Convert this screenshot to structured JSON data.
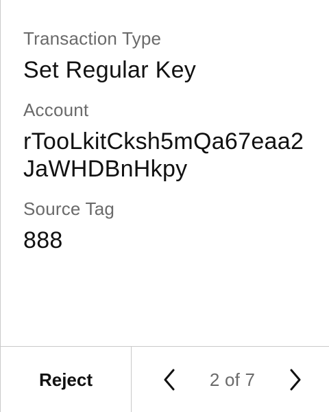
{
  "fields": {
    "transaction_type": {
      "label": "Transaction Type",
      "value": "Set Regular Key"
    },
    "account": {
      "label": "Account",
      "value": "rTooLkitCksh5mQa67eaa2JaWHDBnHkpy"
    },
    "source_tag": {
      "label": "Source Tag",
      "value": "888"
    }
  },
  "footer": {
    "reject_label": "Reject",
    "page_indicator": "2 of 7",
    "prev_icon": "chevron-left-icon",
    "next_icon": "chevron-right-icon"
  },
  "colors": {
    "label": "#6a6a6a",
    "value": "#111111",
    "divider": "#c9c9c9",
    "background": "#ffffff"
  }
}
